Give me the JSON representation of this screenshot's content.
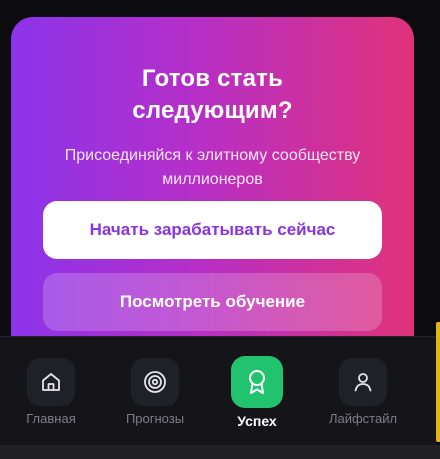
{
  "cta": {
    "title_line1": "Готов стать",
    "title_line2": "следующим?",
    "subtitle_line1": "Присоединяйся к элитному сообществу",
    "subtitle_line2": "миллионеров",
    "primary_button": "Начать зарабатывать сейчас",
    "secondary_button": "Посмотреть обучение"
  },
  "nav": {
    "items": [
      {
        "label": "Главная",
        "icon": "home-icon",
        "active": false
      },
      {
        "label": "Прогнозы",
        "icon": "target-icon",
        "active": false
      },
      {
        "label": "Успех",
        "icon": "award-icon",
        "active": true
      },
      {
        "label": "Лайфстайл",
        "icon": "user-icon",
        "active": false
      }
    ]
  },
  "colors": {
    "gradient_start": "#8b34ea",
    "gradient_end": "#e0327a",
    "active_nav": "#22c36f",
    "primary_button_text": "#8a34e0"
  }
}
